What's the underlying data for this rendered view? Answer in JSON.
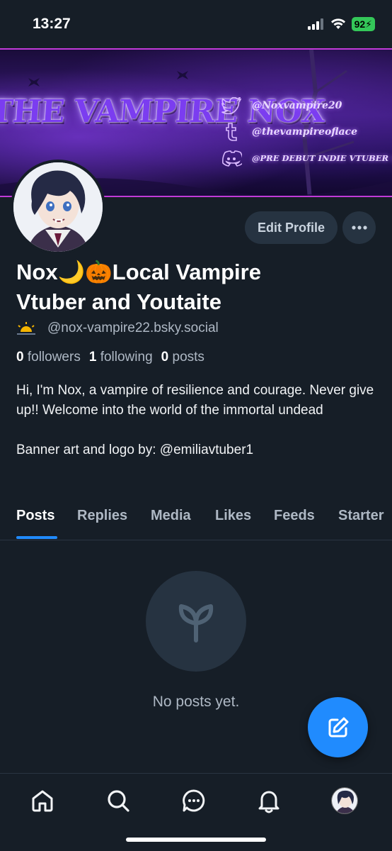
{
  "status_bar": {
    "time": "13:27",
    "battery": "92"
  },
  "banner": {
    "logo_text": "THE VAMPIRE NOX",
    "socials": [
      {
        "icon": "twitter-icon",
        "text": "@Noxvampire20"
      },
      {
        "icon": "tumblr-icon",
        "text": "@thevampireoflace"
      },
      {
        "icon": "discord-icon",
        "text": "@PRE DEBUT INDIE VTUBER | #"
      }
    ]
  },
  "profile": {
    "edit_label": "Edit Profile",
    "display_name": "Nox🌙🎃Local Vampire Vtuber and Youtaite",
    "handle": "@nox-vampire22.bsky.social",
    "followers_count": "0",
    "followers_label": "followers",
    "following_count": "1",
    "following_label": "following",
    "posts_count": "0",
    "posts_label": "posts",
    "bio": "Hi, I'm Nox, a vampire of resilience and courage. Never give up!! Welcome into the world of the immortal undead\n\nBanner art and logo by: @emiliavtuber1"
  },
  "tabs": [
    "Posts",
    "Replies",
    "Media",
    "Likes",
    "Feeds",
    "Starter"
  ],
  "active_tab": "Posts",
  "empty_state": {
    "text": "No posts yet."
  },
  "colors": {
    "accent": "#208bfe",
    "background": "#161e27",
    "banner_border": "#c13ad8"
  },
  "nav": [
    "home-icon",
    "search-icon",
    "chat-icon",
    "bell-icon",
    "profile-avatar"
  ]
}
